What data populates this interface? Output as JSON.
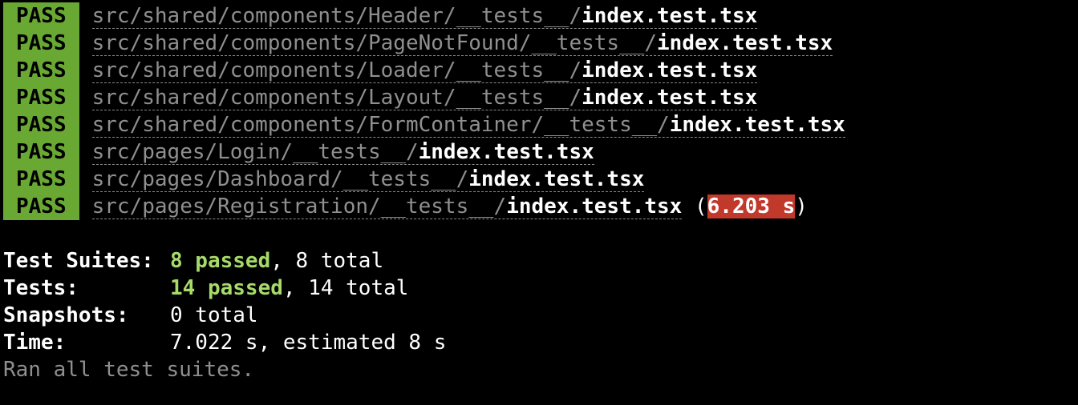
{
  "results": [
    {
      "status": "PASS",
      "dir": "src/shared/components/Header/__tests__/",
      "file": "index.test.tsx"
    },
    {
      "status": "PASS",
      "dir": "src/shared/components/PageNotFound/__tests__/",
      "file": "index.test.tsx"
    },
    {
      "status": "PASS",
      "dir": "src/shared/components/Loader/__tests__/",
      "file": "index.test.tsx"
    },
    {
      "status": "PASS",
      "dir": "src/shared/components/Layout/__tests__/",
      "file": "index.test.tsx"
    },
    {
      "status": "PASS",
      "dir": "src/shared/components/FormContainer/__tests__/",
      "file": "index.test.tsx"
    },
    {
      "status": "PASS",
      "dir": "src/pages/Login/__tests__/",
      "file": "index.test.tsx"
    },
    {
      "status": "PASS",
      "dir": "src/pages/Dashboard/__tests__/",
      "file": "index.test.tsx"
    },
    {
      "status": "PASS",
      "dir": "src/pages/Registration/__tests__/",
      "file": "index.test.tsx",
      "duration": "6.203 s"
    }
  ],
  "summary": {
    "suites": {
      "label": "Test Suites:",
      "passed": "8 passed",
      "rest": ", 8 total"
    },
    "tests": {
      "label": "Tests:",
      "passed": "14 passed",
      "rest": ", 14 total"
    },
    "snapshots": {
      "label": "Snapshots:",
      "value": "0 total"
    },
    "time": {
      "label": "Time:",
      "value": "7.022 s, estimated 8 s"
    }
  },
  "footer": "Ran all test suites.",
  "colors": {
    "background": "#000000",
    "pass_badge": "#6aa834",
    "passed_text": "#a6db6a",
    "slow_badge": "#c0392b",
    "dim_text": "#8f8f8f"
  }
}
